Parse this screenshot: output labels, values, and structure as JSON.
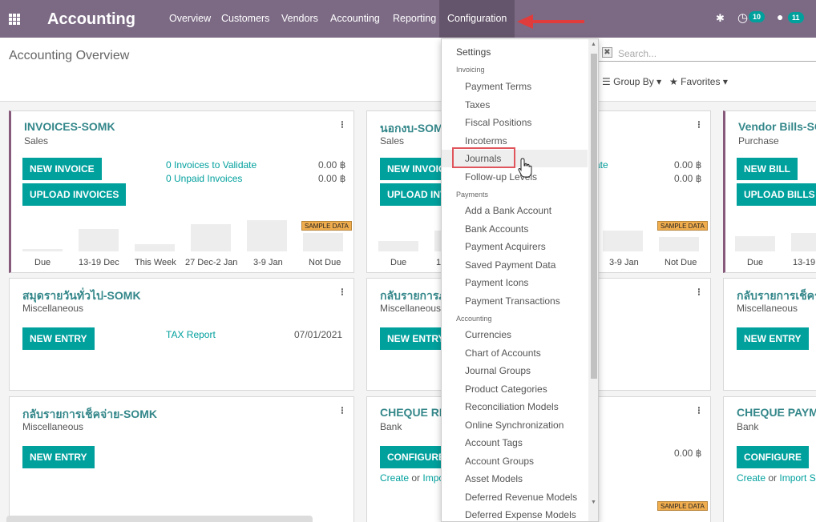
{
  "app": {
    "title": "Accounting"
  },
  "nav": {
    "items": [
      "Overview",
      "Customers",
      "Vendors",
      "Accounting",
      "Reporting",
      "Configuration"
    ],
    "activity_count": "10",
    "messages_count": "11"
  },
  "page": {
    "title": "Accounting Overview"
  },
  "search": {
    "placeholder": "Search...",
    "group_by": "Group By",
    "favorites": "Favorites"
  },
  "sample_label": "SAMPLE DATA",
  "cards": {
    "invoices": {
      "title": "INVOICES-SOMK",
      "subtitle": "Sales",
      "btn1": "NEW INVOICE",
      "btn2": "UPLOAD INVOICES",
      "link1": "0 Invoices to Validate",
      "link2": "0 Unpaid Invoices",
      "amt1": "0.00 ฿",
      "amt2": "0.00 ฿",
      "xlabels": [
        "Due",
        "13-19 Dec",
        "This Week",
        "27 Dec-2 Jan",
        "3-9 Jan",
        "Not Due"
      ]
    },
    "nokngob": {
      "title": "นอกงบ-SOM",
      "subtitle": "Sales",
      "btn1": "NEW INVOIC",
      "btn2": "UPLOAD INV",
      "link_fragment": "ate",
      "amt1": "0.00 ฿",
      "amt2": "0.00 ฿",
      "xlabels": [
        "Due",
        "1",
        "3-9 Jan",
        "Not Due"
      ]
    },
    "vendor": {
      "title": "Vendor Bills-SO",
      "subtitle": "Purchase",
      "btn1": "NEW BILL",
      "btn2": "UPLOAD BILLS",
      "xlabels": [
        "Due",
        "13-19"
      ]
    },
    "misc": {
      "title": "สมุดรายวันทั่วไป-SOMK",
      "subtitle": "Miscellaneous",
      "btn": "NEW ENTRY",
      "link": "TAX Report",
      "date": "07/01/2021"
    },
    "recv_mid": {
      "title": "กลับรายการภ",
      "subtitle": "Miscellaneous",
      "btn": "NEW ENTRY"
    },
    "recv_right": {
      "title": "กลับรายการเช็ครั",
      "subtitle": "Miscellaneous",
      "btn": "NEW ENTRY"
    },
    "cheque_pay": {
      "title": "กลับรายการเช็คจ่าย-SOMK",
      "subtitle": "Miscellaneous",
      "btn": "NEW ENTRY"
    },
    "cheque_mid": {
      "title": "CHEQUE RE",
      "subtitle": "Bank",
      "btn": "CONFIGURE",
      "create": "Create",
      "or": " or ",
      "import": "Impo",
      "amt": "0.00 ฿"
    },
    "cheque_right": {
      "title": "CHEQUE PAYM",
      "subtitle": "Bank",
      "btn": "CONFIGURE",
      "create": "Create",
      "or": " or ",
      "import": "Import S"
    }
  },
  "config_menu": {
    "settings": "Settings",
    "invoicing_header": "Invoicing",
    "invoicing": [
      "Payment Terms",
      "Taxes",
      "Fiscal Positions",
      "Incoterms",
      "Journals",
      "Follow-up Levels"
    ],
    "payments_header": "Payments",
    "payments": [
      "Add a Bank Account",
      "Bank Accounts",
      "Payment Acquirers",
      "Saved Payment Data",
      "Payment Icons",
      "Payment Transactions"
    ],
    "accounting_header": "Accounting",
    "accounting": [
      "Currencies",
      "Chart of Accounts",
      "Journal Groups",
      "Product Categories",
      "Reconciliation Models",
      "Online Synchronization",
      "Account Tags",
      "Account Groups",
      "Asset Models",
      "Deferred Revenue Models",
      "Deferred Expense Models"
    ]
  },
  "colors": {
    "brand": "#7c6a85",
    "accent": "#00a09d",
    "highlight": "#e0555b"
  }
}
